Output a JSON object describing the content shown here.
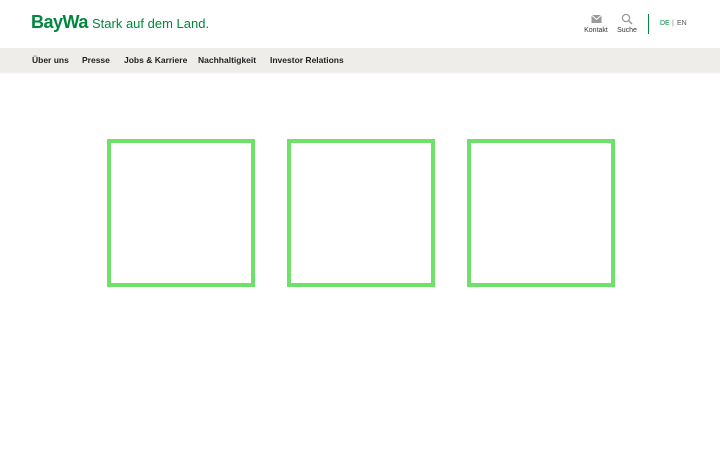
{
  "header": {
    "logo": "BayWa",
    "tagline": "Stark auf dem Land.",
    "utility": [
      {
        "label": "Kontakt",
        "icon": "envelope-icon"
      },
      {
        "label": "Suche",
        "icon": "search-icon"
      }
    ],
    "languages": {
      "active": "DE",
      "separator": "|",
      "other": "EN"
    }
  },
  "nav": {
    "items": [
      "Über uns",
      "Presse",
      "Jobs & Karriere",
      "Nachhaltigkeit",
      "Investor Relations"
    ]
  },
  "colors": {
    "brand": "#00873e",
    "nav_bg": "#efedea",
    "placeholder_outline": "#6ee06b"
  }
}
